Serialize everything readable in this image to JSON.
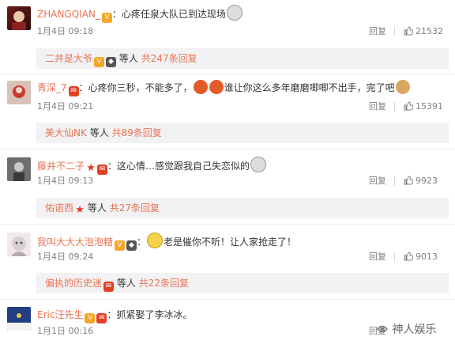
{
  "comments": [
    {
      "username": "ZHANGQIAN_",
      "text": "：心疼任泉大队已到达现场",
      "date": "1月4日 09:18",
      "reply_label": "回复",
      "likes": "21532",
      "sub_users": "二井是大爷",
      "sub_suffix": "等人",
      "sub_count": "共247条回复"
    },
    {
      "username": "青深_7",
      "text_a": "：心疼你三秒，不能多了，",
      "text_b": "谁让你这么多年磨磨唧唧不出手，完了吧",
      "date": "1月4日 09:21",
      "reply_label": "回复",
      "likes": "15391",
      "sub_users": "美大仙NK",
      "sub_suffix": "等人",
      "sub_count": "共89条回复"
    },
    {
      "username": "藤井不二子",
      "text": "：这心情…感觉跟我自己失恋似的",
      "date": "1月4日 09:13",
      "reply_label": "回复",
      "likes": "9923",
      "sub_users": "佑诺西",
      "sub_suffix": "等人",
      "sub_count": "共27条回复"
    },
    {
      "username": "我叫大大大泡泡糖",
      "text": "老是催你不听！让人家抢走了！",
      "date": "1月4日 09:24",
      "reply_label": "回复",
      "likes": "9013",
      "sub_users": "偏执的历史迷",
      "sub_suffix": "等人",
      "sub_count": "共22条回复"
    },
    {
      "username": "Eric汪先生",
      "text": "：抓紧娶了李冰冰。",
      "date": "1月1日 00:16",
      "reply_label": "回复"
    }
  ],
  "watermark": "神人娱乐",
  "colors": {
    "username": "#eb7350",
    "meta": "#808080",
    "subbox": "#f2f2f5"
  }
}
